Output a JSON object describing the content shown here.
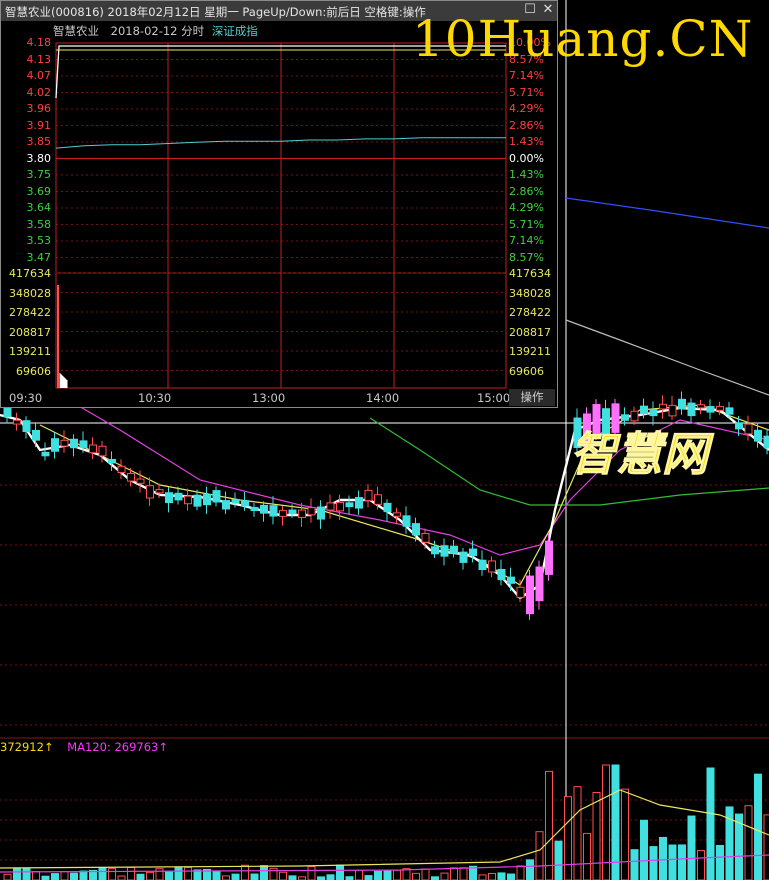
{
  "popup": {
    "title": "智慧农业(000816) 2018年02月12日 星期一 PageUp/Down:前后日 空格键:操作",
    "stock_name": "智慧农业",
    "date_label": "2018-02-12 分时",
    "index_name": "深证成指",
    "operate_button": "操作",
    "price_axis_left": [
      "4.18",
      "4.13",
      "4.07",
      "4.02",
      "3.96",
      "3.91",
      "3.85",
      "3.80",
      "3.75",
      "3.69",
      "3.64",
      "3.58",
      "3.53",
      "3.47"
    ],
    "price_axis_right": [
      "10.00%",
      "8.57%",
      "7.14%",
      "5.71%",
      "4.29%",
      "2.86%",
      "1.43%",
      "0.00%",
      "1.43%",
      "2.86%",
      "4.29%",
      "5.71%",
      "7.14%",
      "8.57%"
    ],
    "volume_axis": [
      "417634",
      "348028",
      "278422",
      "208817",
      "139211",
      "69606"
    ],
    "time_axis": [
      "09:30",
      "10:30",
      "13:00",
      "14:00",
      "15:00"
    ],
    "colors": {
      "up": "#ff4040",
      "down": "#40d040",
      "flat": "#ffffff",
      "index_line": "#4fd0d0"
    }
  },
  "watermark": {
    "text": "10Huang.CN",
    "text_cn": "智慧网"
  },
  "volume_legend": {
    "vol_ma": "372912↑",
    "ma120": "MA120: 269763↑"
  },
  "chart_data": {
    "type": "candlestick",
    "description_series": [
      "price candles",
      "MA5 (white)",
      "MA10 (yellow)",
      "MA20 (magenta)",
      "MA60 (green)",
      "MA120 (blue)",
      "MA250 (grey)"
    ],
    "intraday_index_line_pct": [
      0.9,
      1.1,
      1.2,
      1.2,
      1.3,
      1.4,
      1.5,
      1.5,
      1.5,
      1.6,
      1.6,
      1.7,
      1.7,
      1.8,
      1.8,
      1.8,
      1.8
    ]
  }
}
